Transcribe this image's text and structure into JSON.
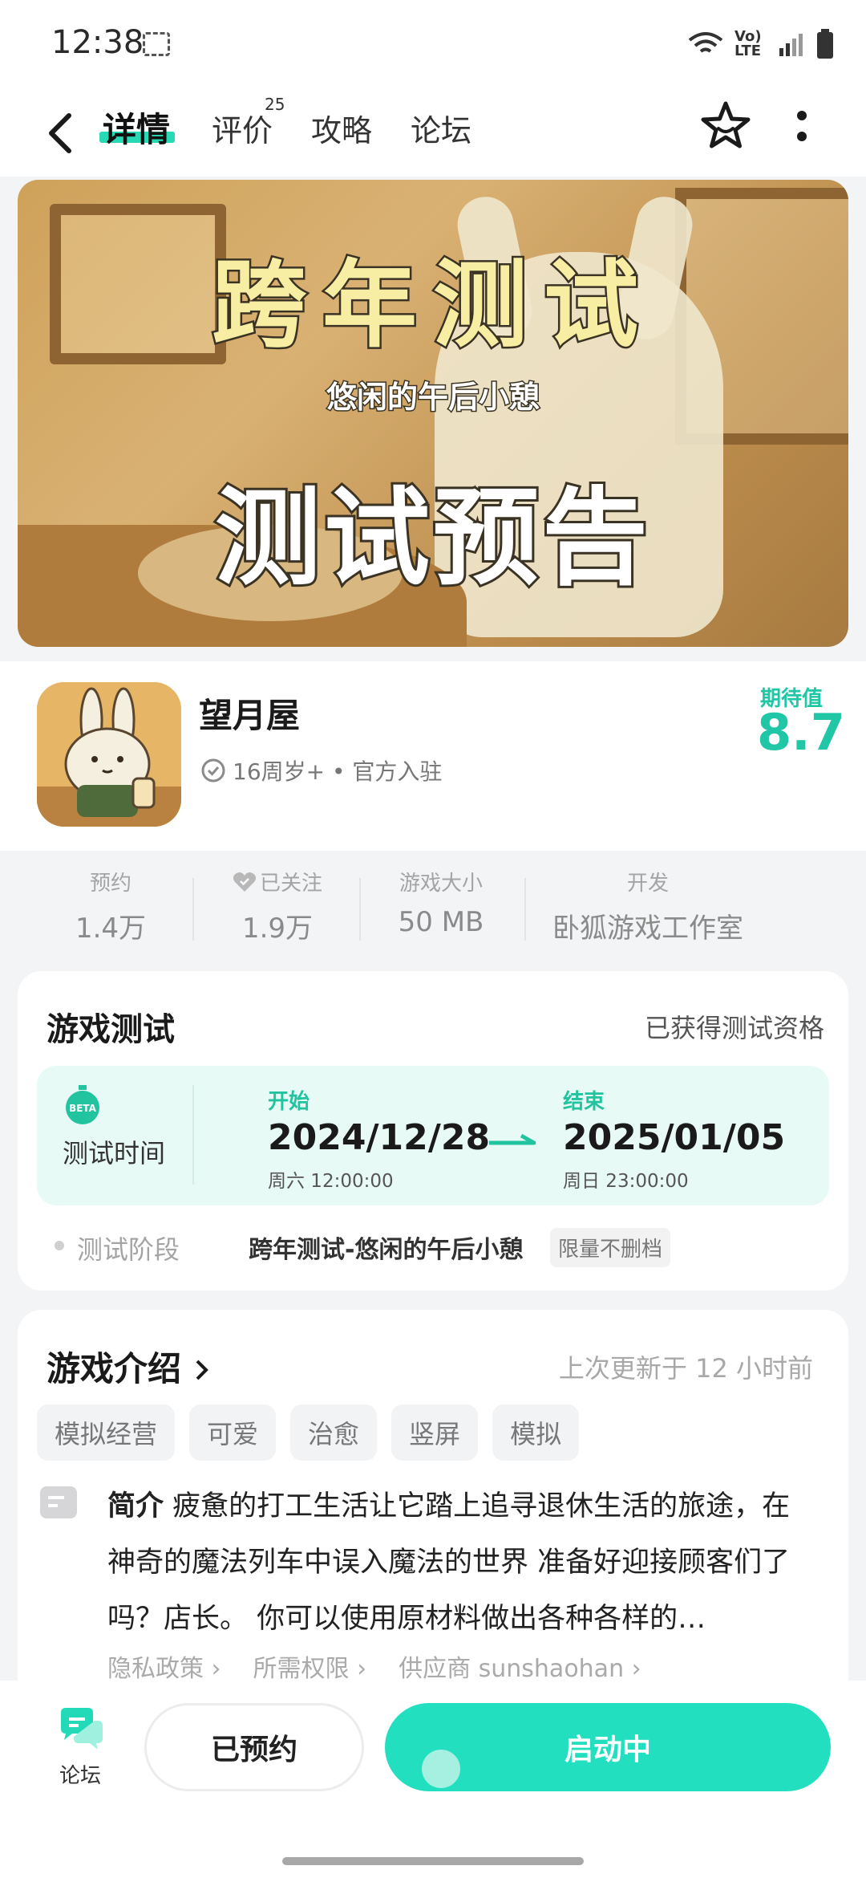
{
  "status_bar": {
    "time": "12:38",
    "network": "Vo) LTE"
  },
  "nav": {
    "tabs": [
      {
        "label": "详情"
      },
      {
        "label": "评价",
        "badge": "25"
      },
      {
        "label": "攻略"
      },
      {
        "label": "论坛"
      }
    ]
  },
  "banner": {
    "title": "跨年测试",
    "subtitle": "悠闲的午后小憩",
    "headline": "测试预告"
  },
  "app": {
    "name": "望月屋",
    "meta": "16周岁+ • 官方入驻",
    "expect_label": "期待值",
    "expect_value": "8.7"
  },
  "stats": [
    {
      "label": "预约",
      "value": "1.4万"
    },
    {
      "label": "已关注",
      "value": "1.9万"
    },
    {
      "label": "游戏大小",
      "value": "50 MB"
    },
    {
      "label": "开发",
      "value": "卧狐游戏工作室"
    }
  ],
  "test": {
    "title": "游戏测试",
    "qualification": "已获得测试资格",
    "time_label": "测试时间",
    "start_label": "开始",
    "start_date": "2024/12/28",
    "start_day": "周六  12:00:00",
    "end_label": "结束",
    "end_date": "2025/01/05",
    "end_day": "周日  23:00:00",
    "stage_label": "测试阶段",
    "stage_value": "跨年测试-悠闲的午后小憩",
    "stage_tag": "限量不删档"
  },
  "intro": {
    "title": "游戏介绍",
    "updated": "上次更新于 12 小时前",
    "tags": [
      "模拟经营",
      "可爱",
      "治愈",
      "竖屏",
      "模拟"
    ],
    "desc_title": "简介",
    "desc_text": "疲惫的打工生活让它踏上追寻退休生活的旅途，在神奇的魔法列车中误入魔法的世界 准备好迎接顾客们了吗？店长。 你可以使用原材料做出各种各样的…",
    "links": [
      "隐私政策",
      "所需权限",
      "供应商 sunshaohan"
    ]
  },
  "bottom": {
    "forum_label": "论坛",
    "reserved_label": "已预约",
    "launch_label": "启动中"
  },
  "colors": {
    "accent": "#22e0bf",
    "accent_text": "#20c7a6"
  }
}
